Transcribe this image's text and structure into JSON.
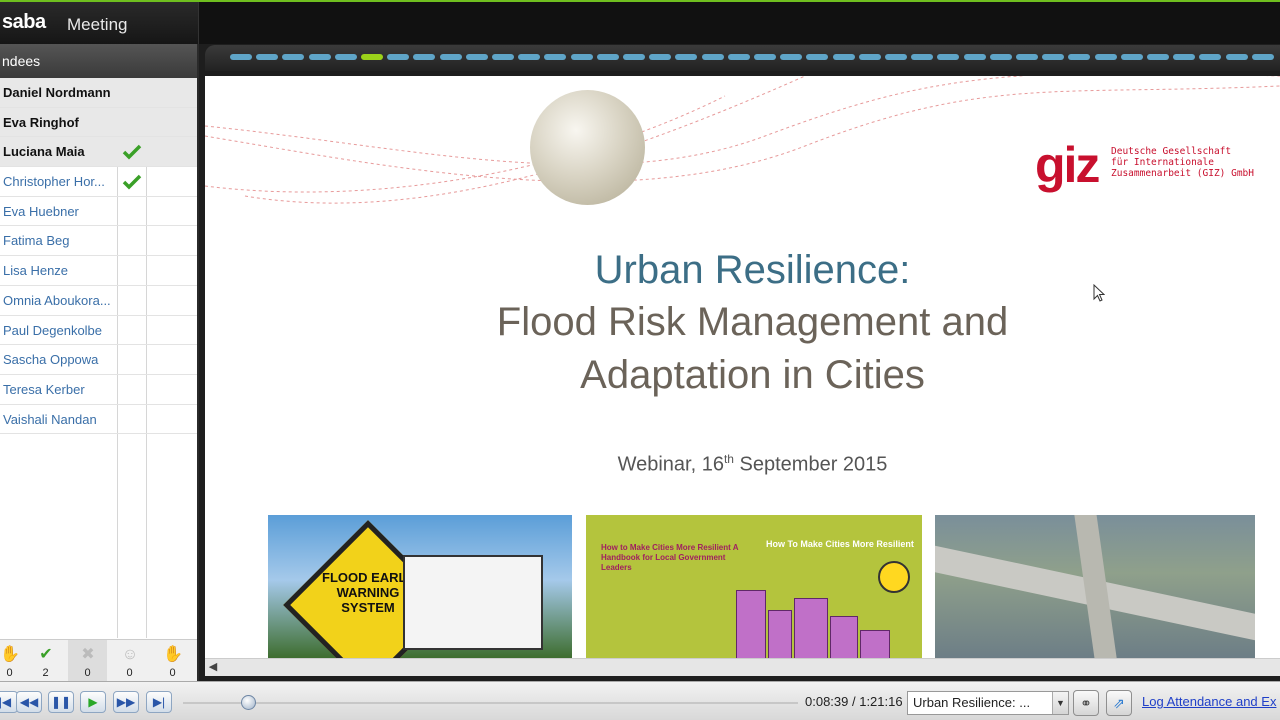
{
  "header": {
    "brand": "saba",
    "product": "Meeting"
  },
  "sidebar": {
    "title": "ndees",
    "attendees": [
      {
        "name": "Daniel Nordmann",
        "role": "presenter",
        "checked": false
      },
      {
        "name": "Eva Ringhof",
        "role": "presenter",
        "checked": false
      },
      {
        "name": "Luciana Maia",
        "role": "presenter",
        "checked": true
      },
      {
        "name": "Christopher Hor...",
        "role": "attendee",
        "checked": true
      },
      {
        "name": "Eva Huebner",
        "role": "attendee",
        "checked": false
      },
      {
        "name": "Fatima Beg",
        "role": "attendee",
        "checked": false
      },
      {
        "name": "Lisa Henze",
        "role": "attendee",
        "checked": false
      },
      {
        "name": "Omnia Aboukora...",
        "role": "attendee",
        "checked": false
      },
      {
        "name": "Paul Degenkolbe",
        "role": "attendee",
        "checked": false
      },
      {
        "name": "Sascha Oppowa",
        "role": "attendee",
        "checked": false
      },
      {
        "name": "Teresa Kerber",
        "role": "attendee",
        "checked": false
      },
      {
        "name": "Vaishali Nandan",
        "role": "attendee",
        "checked": false
      }
    ],
    "feedback": [
      {
        "icon": "raise-hand-icon",
        "count": "0"
      },
      {
        "icon": "checkmark-icon",
        "count": "2"
      },
      {
        "icon": "cross-icon",
        "count": "0"
      },
      {
        "icon": "smiley-icon",
        "count": "0"
      },
      {
        "icon": "applause-icon",
        "count": "0"
      }
    ]
  },
  "slides": {
    "total": 40,
    "current": 6
  },
  "slide": {
    "title_line1": "Urban Resilience:",
    "title_line2": "Flood Risk Management and",
    "title_line3": "Adaptation in Cities",
    "subtitle_prefix": "Webinar, 16",
    "subtitle_sup": "th",
    "subtitle_suffix": " September 2015",
    "logo_word": "giz",
    "logo_org": "Deutsche Gesellschaft\nfür Internationale\nZusammenarbeit (GIZ) GmbH",
    "photo1_sign": "FLOOD EARLY WARNING SYSTEM",
    "photo2_title": "How To Make Cities More Resilient",
    "photo2_heading": "How to Make Cities More Resilient A Handbook for Local Government Leaders"
  },
  "player": {
    "time": "0:08:39 / 1:21:16",
    "track": "Urban Resilience: ...",
    "log_link": "Log Attendance and Ex",
    "progress": 0.106
  },
  "colors": {
    "accent_green": "#6fbf1f",
    "title_blue": "#3c6e86",
    "giz_red": "#c8102e",
    "link_blue": "#1f3fc8"
  }
}
